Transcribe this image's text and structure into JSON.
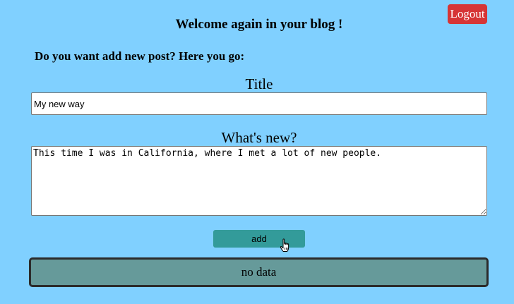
{
  "header": {
    "logout_label": "Logout",
    "welcome_text": "Welcome again in your blog !"
  },
  "form": {
    "prompt": "Do you want add new post? Here you go:",
    "title_label": "Title",
    "title_value": "My new way",
    "body_label": "What's new?",
    "body_value": "This time I was in California, where I met a lot of new people.",
    "add_label": "add"
  },
  "posts": {
    "empty_text": "no data"
  },
  "colors": {
    "background": "#80d0ff",
    "logout_bg": "#d63536",
    "add_bg": "#339b9a",
    "nodata_bg": "#669a9a"
  },
  "icons": {
    "cursor": "hand-pointer-icon"
  }
}
